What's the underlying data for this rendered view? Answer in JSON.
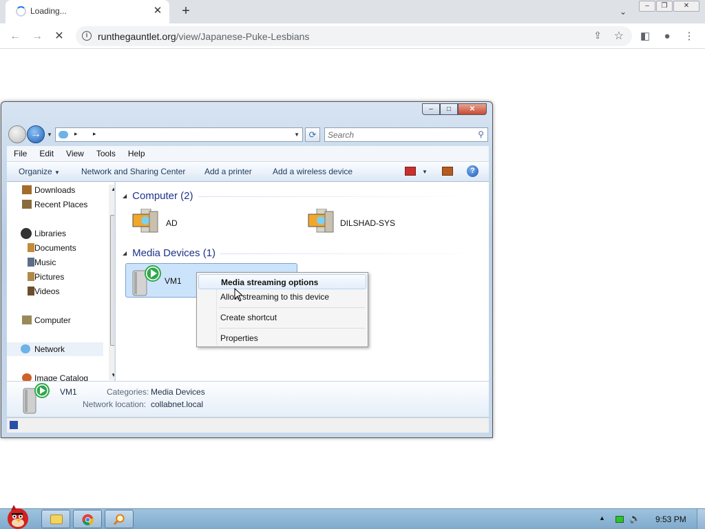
{
  "browser": {
    "tab_title": "Loading...",
    "url_host": "runthegauntlet.org",
    "url_path": "/view/Japanese-Puke-Lesbians"
  },
  "explorer": {
    "search_placeholder": "Search",
    "menu": [
      "File",
      "Edit",
      "View",
      "Tools",
      "Help"
    ],
    "commands": {
      "organize": "Organize",
      "network_sharing": "Network and Sharing Center",
      "add_printer": "Add a printer",
      "add_wireless": "Add a wireless device"
    },
    "nav": {
      "downloads": "Downloads",
      "recent": "Recent Places",
      "libraries": "Libraries",
      "documents": "Documents",
      "music": "Music",
      "pictures": "Pictures",
      "videos": "Videos",
      "computer": "Computer",
      "network": "Network",
      "image_catalog": "Image Catalog"
    },
    "groups": {
      "computer": "Computer (2)",
      "media": "Media Devices (1)"
    },
    "items": {
      "ad": "AD",
      "dilshad": "DILSHAD-SYS",
      "vm1": "VM1"
    },
    "context_menu": {
      "media_options": "Media streaming options",
      "allow_streaming": "Allow streaming to this device",
      "create_shortcut": "Create shortcut",
      "properties": "Properties"
    },
    "details": {
      "name": "VM1",
      "categories_label": "Categories:",
      "categories_value": "Media Devices",
      "location_label": "Network location:",
      "location_value": "collabnet.local"
    }
  },
  "taskbar": {
    "clock": "9:53 PM"
  },
  "colors": {
    "group_header": "#1e3287",
    "selection": "#cce4fb",
    "play_green": "#2fa84a"
  }
}
